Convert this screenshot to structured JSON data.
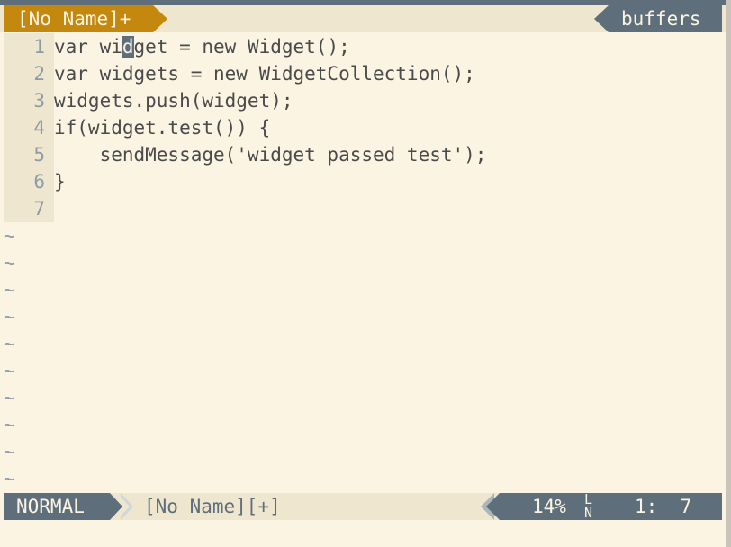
{
  "tabline": {
    "current_tab": "[No Name]+",
    "right_label": "buffers"
  },
  "editor": {
    "lines": [
      {
        "num": "1",
        "before_cursor": "var wi",
        "cursor_char": "d",
        "after_cursor": "get = new Widget();"
      },
      {
        "num": "2",
        "text": "var widgets = new WidgetCollection();"
      },
      {
        "num": "3",
        "text": "widgets.push(widget);"
      },
      {
        "num": "4",
        "text": "if(widget.test()) {"
      },
      {
        "num": "5",
        "text": "    sendMessage('widget passed test');"
      },
      {
        "num": "6",
        "text": "}"
      },
      {
        "num": "7",
        "text": ""
      }
    ],
    "tilde": "~"
  },
  "statusline": {
    "mode": "NORMAL",
    "filename": "[No Name][+]",
    "percent": "14%",
    "ln_icon_top": "L",
    "ln_icon_bottom": "N",
    "line_col": "1:  7"
  }
}
